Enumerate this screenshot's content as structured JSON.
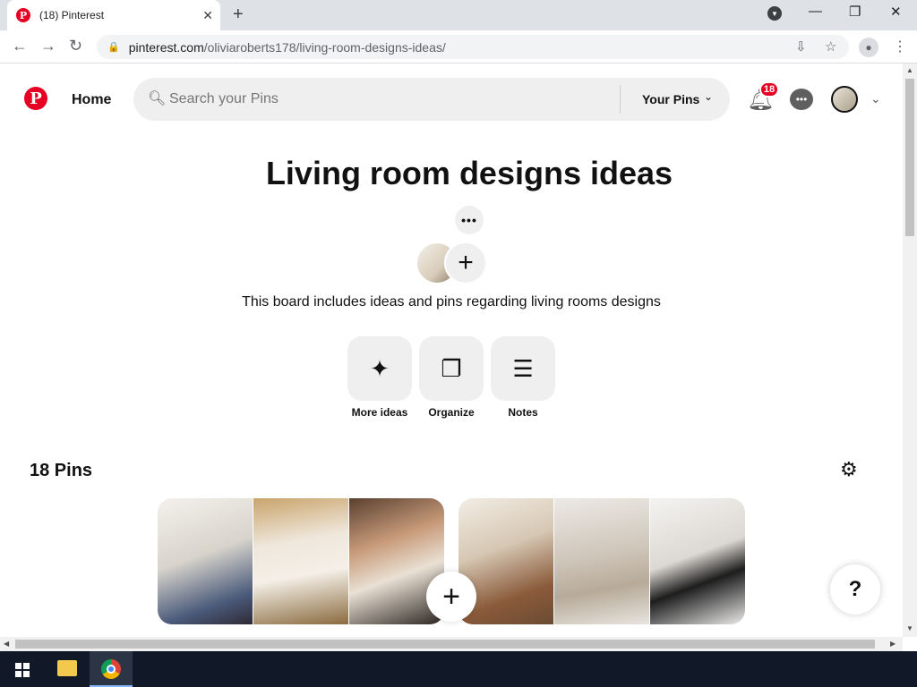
{
  "browser": {
    "tab_title": "(18) Pinterest",
    "url_host": "pinterest.com",
    "url_path": "/oliviaroberts178/living-room-designs-ideas/"
  },
  "header": {
    "home_label": "Home",
    "search_placeholder": "Search your Pins",
    "your_pins_label": "Your Pins",
    "notification_count": "18"
  },
  "board": {
    "title": "Living room designs ideas",
    "description": "This board includes ideas and pins regarding living rooms designs",
    "actions": [
      {
        "label": "More ideas",
        "icon": "sparkle-icon"
      },
      {
        "label": "Organize",
        "icon": "organize-icon"
      },
      {
        "label": "Notes",
        "icon": "notes-icon"
      }
    ],
    "pin_count_label": "18 Pins"
  },
  "help_label": "?",
  "colors": {
    "brand": "#e60023",
    "chip_bg": "#efefef"
  }
}
